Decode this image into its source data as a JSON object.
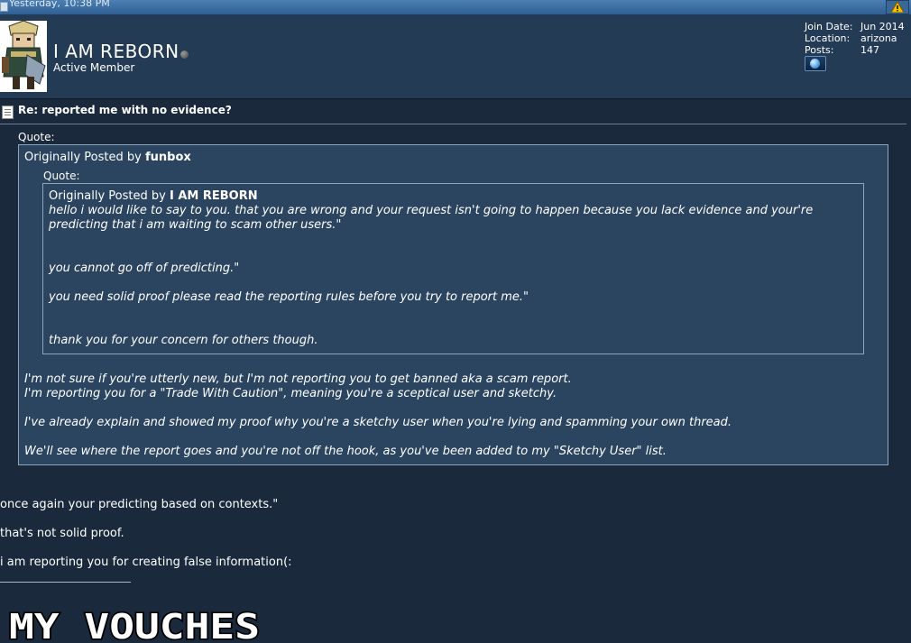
{
  "topbar": {
    "date": "Yesterday, 10:38 PM",
    "warn_icon": "warning-triangle-icon"
  },
  "user": {
    "name": "I AM REBORN",
    "title": "Active Member",
    "status_icon": "offline-status-icon",
    "info": [
      {
        "label": "Join Date:",
        "value": "Jun 2014"
      },
      {
        "label": "Location:",
        "value": "arizona"
      },
      {
        "label": "Posts:",
        "value": "147"
      }
    ],
    "homepage_icon": "globe-icon"
  },
  "post": {
    "title": "Re: reported me with no evidence?",
    "outer_quote": {
      "label": "Quote:",
      "prefix": "Originally Posted by",
      "author": "funbox",
      "inner_quote": {
        "label": "Quote:",
        "prefix": "Originally Posted by",
        "author": "I AM REBORN",
        "lines": [
          "hello i would like to say to you. that you are wrong and your request isn't going to happen because you lack evidence and your're",
          "predicting that i am waiting to scam other users.\"",
          "you cannot go off of predicting.\"",
          "you need solid proof please read the reporting rules before you try to report me.\"",
          "thank you for your concern for others though."
        ]
      },
      "lines": [
        "I'm not sure if you're utterly new, but I'm not reporting you to get banned aka a scam report.",
        "I'm reporting you for a \"Trade With Caution\", meaning you're a sceptical user and sketchy.",
        "I've already explain and showed my proof why you're a sketchy user when you're lying and spamming your own thread.",
        "We'll see where the report goes and you're not off the hook, as you've been added to my \"Sketchy User\" list."
      ]
    },
    "body_lines": [
      "once again your predicting based on contexts.\"",
      "that's not solid proof.",
      "i am reporting you for creating false information(:"
    ],
    "signature_banner": "MY VOUCHES"
  }
}
